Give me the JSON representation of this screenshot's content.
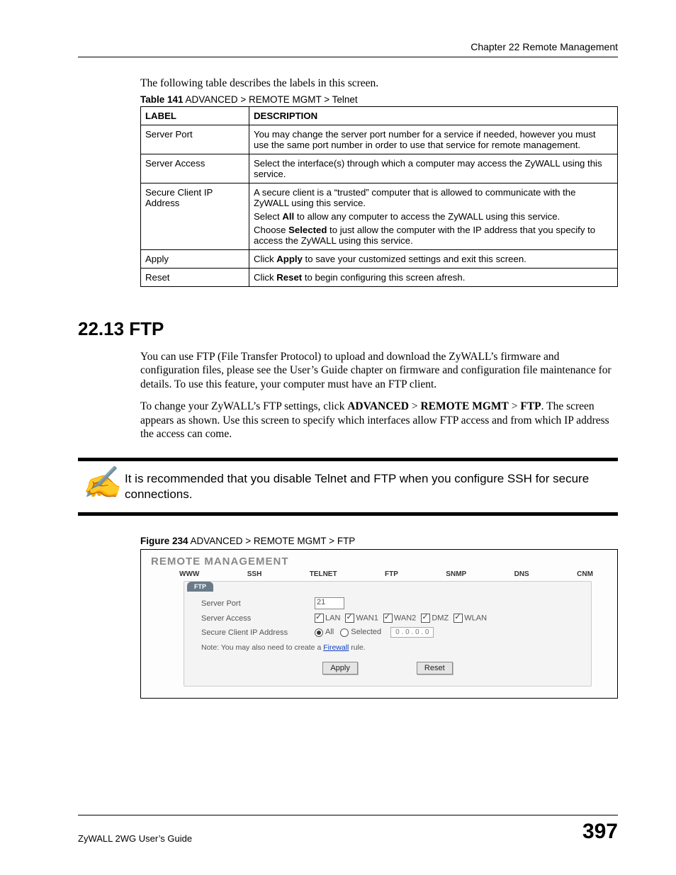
{
  "header": {
    "chapter": "Chapter 22 Remote Management"
  },
  "intro": "The following table describes the labels in this screen.",
  "table141_caption_bold": "Table 141",
  "table141_caption_rest": "   ADVANCED > REMOTE MGMT > Telnet",
  "th_label": "LABEL",
  "th_desc": "DESCRIPTION",
  "rows": {
    "r0_label": "Server Port",
    "r0_desc": "You may change the server port number for a service if needed, however you must use the same port number in order to use that service for remote management.",
    "r1_label": "Server Access",
    "r1_desc": "Select the interface(s) through which a computer may access the ZyWALL using this service.",
    "r2_label": "Secure Client IP Address",
    "r2_desc_a": "A secure client is a “trusted” computer that is allowed to communicate with the ZyWALL using this service.",
    "r2_desc_b_pre": "Select ",
    "r2_desc_b_bold": "All",
    "r2_desc_b_post": " to allow any computer to access the ZyWALL using this service.",
    "r2_desc_c_pre": "Choose ",
    "r2_desc_c_bold": "Selected",
    "r2_desc_c_post": " to just allow the computer with the IP address that you specify to access the ZyWALL using this service.",
    "r3_label": "Apply",
    "r3_desc_pre": "Click ",
    "r3_desc_bold": "Apply",
    "r3_desc_post": " to save your customized settings and exit this screen.",
    "r4_label": "Reset",
    "r4_desc_pre": "Click ",
    "r4_desc_bold": "Reset",
    "r4_desc_post": " to begin configuring this screen afresh."
  },
  "section_title": "22.13  FTP",
  "p1": "You can use FTP (File Transfer Protocol) to upload and download the ZyWALL’s firmware and configuration files, please see the User’s Guide chapter on firmware and configuration file maintenance for details. To use this feature, your computer must have an FTP client.",
  "p2_a": "To change your ZyWALL’s FTP settings, click ",
  "p2_b1": "ADVANCED",
  "p2_gt1": " > ",
  "p2_b2": "REMOTE MGMT",
  "p2_gt2": " > ",
  "p2_b3": "FTP",
  "p2_end": ". The screen appears as shown. Use this screen to specify which interfaces allow FTP access and from which IP address the access can come.",
  "note_text": "It is recommended that you disable Telnet and FTP when you configure SSH for secure connections.",
  "fig_caption_bold": "Figure 234",
  "fig_caption_rest": "   ADVANCED > REMOTE MGMT > FTP",
  "screenshot": {
    "title": "REMOTE MANAGEMENT",
    "tabs": {
      "t0": "WWW",
      "t1": "SSH",
      "t2": "TELNET",
      "t3": "FTP",
      "t4": "SNMP",
      "t5": "DNS",
      "t6": "CNM"
    },
    "panel_head": "FTP",
    "lbl_port": "Server Port",
    "val_port": "21",
    "lbl_access": "Server Access",
    "chk": {
      "c0": "LAN",
      "c1": "WAN1",
      "c2": "WAN2",
      "c3": "DMZ",
      "c4": "WLAN"
    },
    "lbl_secure": "Secure Client IP Address",
    "radio_all": "All",
    "radio_sel": "Selected",
    "ip": "0   .   0   .   0   .   0",
    "noteline_a": "Note: You may also need to create a ",
    "noteline_link": "Firewall",
    "noteline_b": " rule.",
    "btn_apply": "Apply",
    "btn_reset": "Reset"
  },
  "footer": {
    "left": "ZyWALL 2WG User’s Guide",
    "page": "397"
  }
}
